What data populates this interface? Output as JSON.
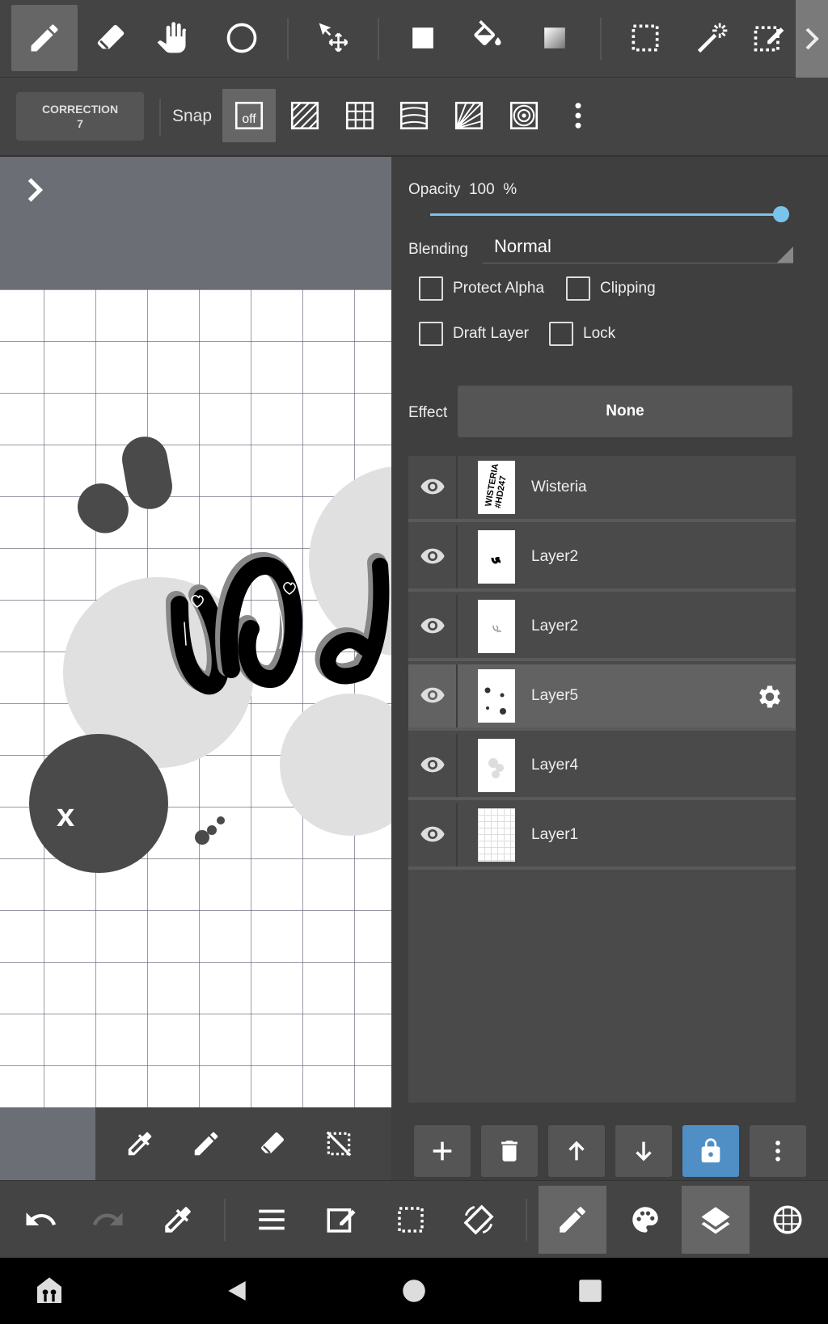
{
  "toolbar": {
    "tools": [
      {
        "icon": "pen-icon",
        "active": true
      },
      {
        "icon": "eraser-icon"
      },
      {
        "icon": "hand-icon"
      },
      {
        "icon": "circle-shape-icon"
      },
      {
        "icon": "move-icon"
      },
      {
        "icon": "fill-rect-icon"
      },
      {
        "icon": "bucket-icon"
      },
      {
        "icon": "gradient-icon"
      },
      {
        "icon": "select-rect-icon"
      },
      {
        "icon": "magic-wand-icon"
      },
      {
        "icon": "select-pen-icon"
      }
    ]
  },
  "subbar": {
    "correction_label": "CORRECTION",
    "correction_value": "7",
    "snap_label": "Snap",
    "snap_off": "off"
  },
  "panel": {
    "opacity_label": "Opacity",
    "opacity_value": "100",
    "opacity_unit": "%",
    "opacity_fraction": 1.0,
    "blending_label": "Blending",
    "blending_value": "Normal",
    "protect_alpha": "Protect Alpha",
    "clipping": "Clipping",
    "draft_layer": "Draft Layer",
    "lock": "Lock",
    "effect_label": "Effect",
    "effect_value": "None"
  },
  "layers": [
    {
      "name": "Wisteria",
      "thumb_text": "WISTERIA #HD247",
      "selected": false
    },
    {
      "name": "Layer2",
      "selected": false
    },
    {
      "name": "Layer2",
      "selected": false
    },
    {
      "name": "Layer5",
      "selected": true
    },
    {
      "name": "Layer4",
      "selected": false
    },
    {
      "name": "Layer1",
      "selected": false
    }
  ],
  "canvas": {
    "letter_mark": "x"
  },
  "colors": {
    "accent": "#7ac4ec",
    "lock_blue": "#4f8fc6",
    "toolbar_bg": "#444444",
    "panel_bg": "#3f3f3f"
  }
}
